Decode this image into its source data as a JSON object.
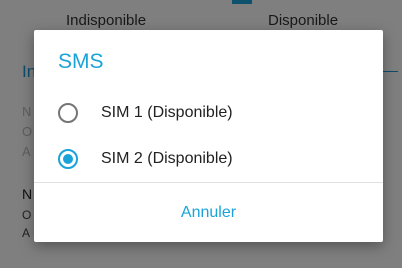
{
  "background": {
    "status_left": "Indisponible",
    "status_right": "Disponible",
    "section_partial": "In",
    "faded_lines": [
      "N",
      "O",
      "A"
    ],
    "strong_partial": "N",
    "small_lines": [
      "O",
      "A"
    ]
  },
  "dialog": {
    "title": "SMS",
    "options": [
      {
        "label": "SIM 1 (Disponible)",
        "selected": false
      },
      {
        "label": "SIM 2 (Disponible)",
        "selected": true
      }
    ],
    "cancel_label": "Annuler"
  },
  "colors": {
    "accent": "#1aa3d9",
    "scrim": "rgba(0,0,0,0.5)"
  }
}
